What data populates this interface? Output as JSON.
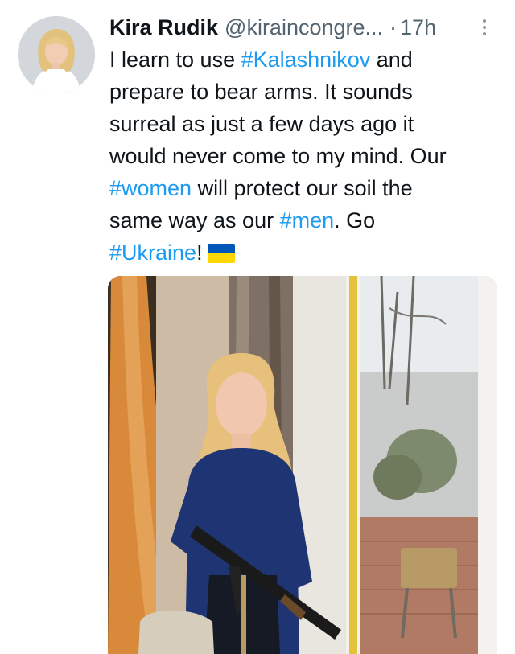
{
  "author": {
    "name": "Kira Rudik",
    "handle": "@kiraincongre...",
    "separator": "·",
    "time": "17h"
  },
  "tweet": {
    "lines": [
      [
        {
          "t": "I learn to use ",
          "tag": false
        },
        {
          "t": "#Kalashnikov",
          "tag": true
        },
        {
          "t": " and",
          "tag": false
        }
      ],
      [
        {
          "t": "prepare to bear arms. It sounds",
          "tag": false
        }
      ],
      [
        {
          "t": "surreal as just a few days ago it",
          "tag": false
        }
      ],
      [
        {
          "t": "would never come to my mind. Our",
          "tag": false
        }
      ],
      [
        {
          "t": "#women",
          "tag": true
        },
        {
          "t": " will protect our soil the",
          "tag": false
        }
      ],
      [
        {
          "t": "same way as our ",
          "tag": false
        },
        {
          "t": "#men",
          "tag": true
        },
        {
          "t": ". Go",
          "tag": false
        }
      ],
      [
        {
          "t": "#Ukraine",
          "tag": true
        },
        {
          "t": "!",
          "tag": false
        }
      ]
    ],
    "emoji": "ukraine-flag"
  },
  "icons": {
    "more": "more-vertical-icon",
    "flag": "ukraine-flag-icon"
  },
  "colors": {
    "hashtag": "#1d9bf0",
    "text": "#0f1419",
    "secondary": "#536471",
    "flag_blue": "#0057b7",
    "flag_yellow": "#ffd700"
  }
}
